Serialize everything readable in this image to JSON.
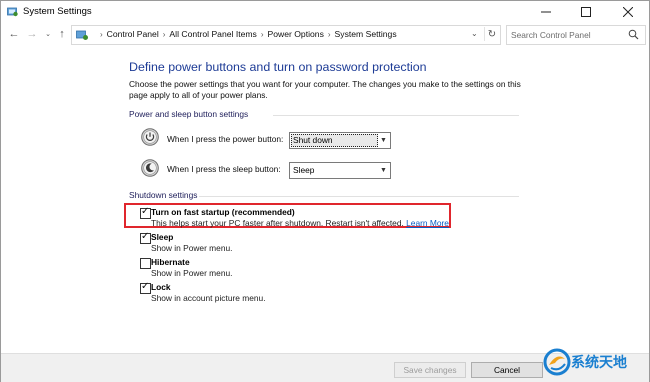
{
  "window": {
    "title": "System Settings",
    "controls": [
      "minimize-icon",
      "maximize-icon",
      "close-icon"
    ]
  },
  "address_bar": {
    "breadcrumbs": [
      "Control Panel",
      "All Control Panel Items",
      "Power Options",
      "System Settings"
    ],
    "search_placeholder": "Search Control Panel"
  },
  "main": {
    "heading": "Define power buttons and turn on password protection",
    "intro": "Choose the power settings that you want for your computer. The changes you make to the settings on this page apply to all of your power plans.",
    "power_section": {
      "title": "Power and sleep button settings",
      "rows": [
        {
          "label": "When I press the power button:",
          "value": "Shut down",
          "icon": "power-button-icon"
        },
        {
          "label": "When I press the sleep button:",
          "value": "Sleep",
          "icon": "sleep-button-icon"
        }
      ]
    },
    "shutdown_section": {
      "title": "Shutdown settings",
      "items": [
        {
          "label": "Turn on fast startup (recommended)",
          "desc": "This helps start your PC faster after shutdown. Restart isn't affected.",
          "link": "Learn More",
          "checked": true
        },
        {
          "label": "Sleep",
          "desc": "Show in Power menu.",
          "checked": true
        },
        {
          "label": "Hibernate",
          "desc": "Show in Power menu.",
          "checked": false
        },
        {
          "label": "Lock",
          "desc": "Show in account picture menu.",
          "checked": true
        }
      ]
    }
  },
  "footer": {
    "save_label": "Save changes",
    "cancel_label": "Cancel"
  },
  "watermark": {
    "text": "系统天地"
  },
  "colors": {
    "heading": "#1e3c96",
    "link": "#0a5cc2",
    "highlight": "#e0262d",
    "watermark": "#1a7fd0"
  }
}
